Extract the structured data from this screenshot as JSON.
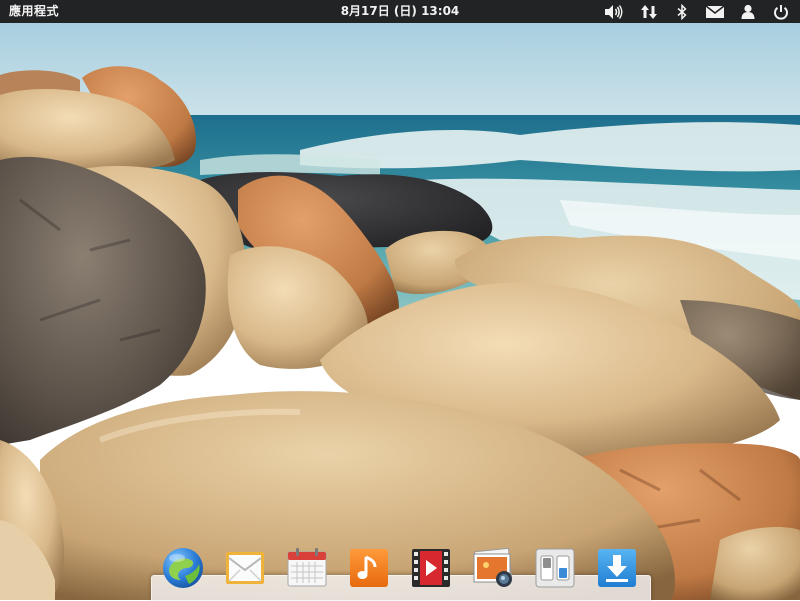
{
  "top_panel": {
    "apps_label": "應用程式",
    "clock": "8月17日 (日) 13:04",
    "indicators": [
      "volume-icon",
      "network-icon",
      "bluetooth-icon",
      "messages-icon",
      "user-icon",
      "power-icon"
    ]
  },
  "dock": {
    "items": [
      "web-browser-icon",
      "mail-icon",
      "calendar-icon",
      "music-icon",
      "videos-icon",
      "photos-icon",
      "system-settings-icon",
      "app-center-icon"
    ]
  },
  "colors": {
    "panel": "#212325",
    "panel_text": "#f2f2f2",
    "dock_background": "#f4f4f4"
  }
}
